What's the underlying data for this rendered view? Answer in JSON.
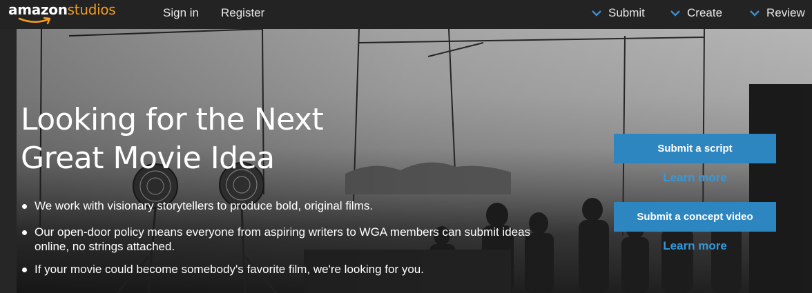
{
  "header": {
    "logo_main": "amazon",
    "logo_accent": "studios",
    "links": {
      "sign_in": "Sign in",
      "register": "Register"
    },
    "menus": {
      "submit": "Submit",
      "create": "Create",
      "review": "Review"
    },
    "colors": {
      "bar": "#232323",
      "logo_accent": "#f39c1f"
    }
  },
  "hero": {
    "headline": "Looking for the Next Great Movie Idea",
    "bullets": [
      "We work with visionary storytellers to produce bold, original films.",
      "Our open-door policy means everyone from aspiring writers to WGA members can submit ideas online, no strings attached.",
      "If your movie could become somebody's favorite film, we're looking for you."
    ],
    "actions": {
      "submit_script": "Submit a script",
      "learn_more_1": "Learn more",
      "submit_video": "Submit a concept video",
      "learn_more_2": "Learn more"
    },
    "colors": {
      "button": "#2e86c1",
      "link": "#3498db"
    }
  }
}
